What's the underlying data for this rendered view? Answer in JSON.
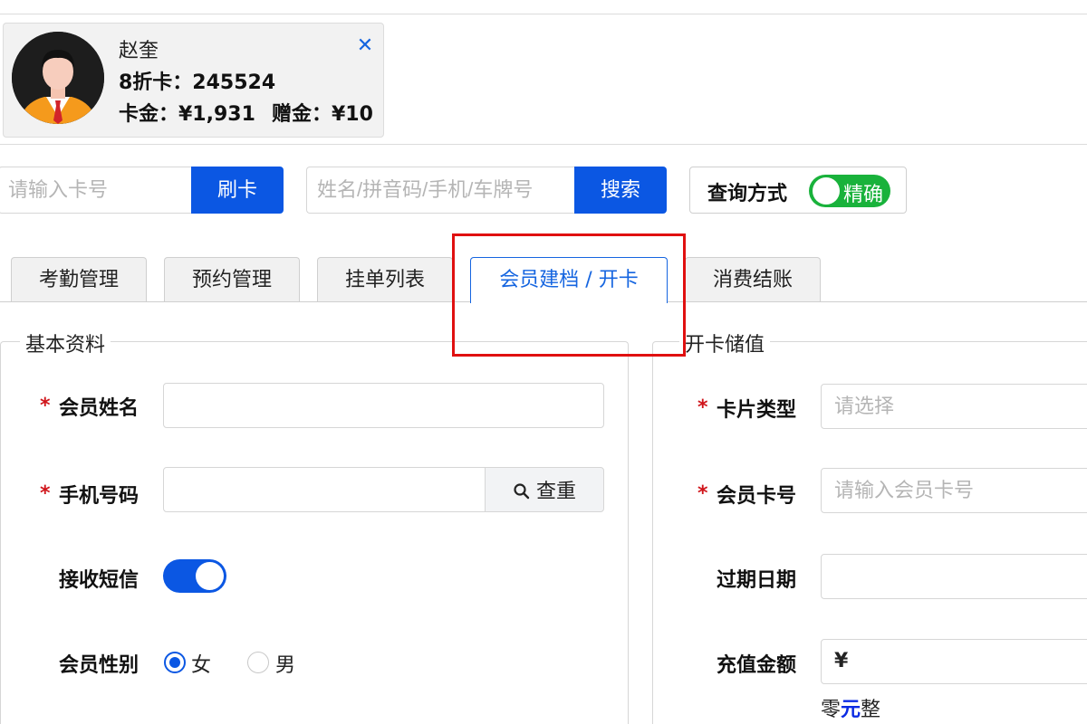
{
  "member": {
    "name": "赵奎",
    "card_line": "8折卡：245524",
    "balance_label": "卡金：¥1,931",
    "bonus_label": "赠金：¥10",
    "close_symbol": "✕"
  },
  "search": {
    "card_placeholder": "请输入卡号",
    "swipe_button": "刷卡",
    "keyword_placeholder": "姓名/拼音码/手机/车牌号",
    "search_button": "搜索",
    "query_mode_label": "查询方式",
    "query_mode_value": "精确"
  },
  "tabs": [
    {
      "label": "考勤管理"
    },
    {
      "label": "预约管理"
    },
    {
      "label": "挂单列表"
    },
    {
      "label": "会员建档 / 开卡"
    },
    {
      "label": "消费结账"
    }
  ],
  "active_tab": 3,
  "basic_info": {
    "legend": "基本资料",
    "name_label": "会员姓名",
    "phone_label": "手机号码",
    "check_button": "查重",
    "sms_label": "接收短信",
    "sms_enabled": true,
    "gender_label": "会员性别",
    "gender_female": "女",
    "gender_male": "男",
    "gender_selected": "女"
  },
  "card_value": {
    "legend": "开卡储值",
    "card_type_label": "卡片类型",
    "card_type_placeholder": "请选择",
    "card_no_label": "会员卡号",
    "card_no_placeholder": "请输入会员卡号",
    "expiry_label": "过期日期",
    "amount_label": "充值金额",
    "amount_prefix": "¥",
    "amount_words_prefix": "零",
    "amount_words_unit": "元",
    "amount_words_suffix": "整"
  },
  "required_mark": "*",
  "colors": {
    "primary": "#0b57e3",
    "toggle_green": "#19b23b",
    "required": "#d0151b",
    "highlight": "#e01010"
  }
}
